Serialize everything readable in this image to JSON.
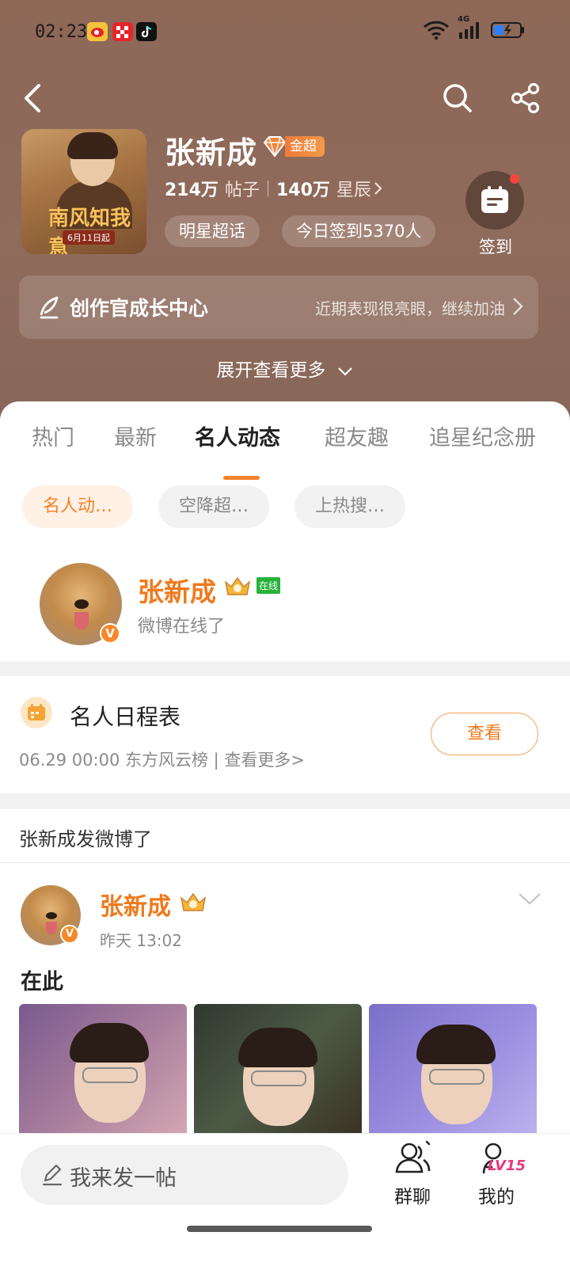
{
  "status_bar": {
    "time": "02:23",
    "network": "4G"
  },
  "profile": {
    "name": "张新成",
    "badge": "金超",
    "posts_count": "214万",
    "posts_unit": "帖子",
    "stars_count": "140万",
    "stars_unit": "星辰",
    "tags": [
      "明星超话",
      "今日签到5370人"
    ],
    "checkin_label": "签到",
    "poster_title": "南风知我意",
    "poster_date": "6月11日起"
  },
  "creator_center": {
    "title": "创作官成长中心",
    "hint": "近期表现很亮眼，继续加油"
  },
  "expand_label": "展开查看更多",
  "tabs": [
    {
      "label": "热门"
    },
    {
      "label": "最新"
    },
    {
      "label": "名人动态"
    },
    {
      "label": "超友趣"
    },
    {
      "label": "追星纪念册"
    }
  ],
  "filters": [
    "名人动…",
    "空降超…",
    "上热搜…"
  ],
  "online": {
    "name": "张新成",
    "tag": "在线",
    "status": "微博在线了"
  },
  "schedule": {
    "title": "名人日程表",
    "meta": "06.29  00:00   东方风云榜 |   查看更多>",
    "button": "查看"
  },
  "feed": {
    "header": "张新成发微博了",
    "post": {
      "author": "张新成",
      "time": "昨天  13:02",
      "text": "在此"
    }
  },
  "bottom_bar": {
    "placeholder": "我来发一帖",
    "group_chat": "群聊",
    "mine": "我的",
    "level": "LV15"
  },
  "colors": {
    "accent": "#f5822a",
    "hero_bg": "#8e6757",
    "verified": "#f5882a",
    "online_green": "#27b23b"
  }
}
